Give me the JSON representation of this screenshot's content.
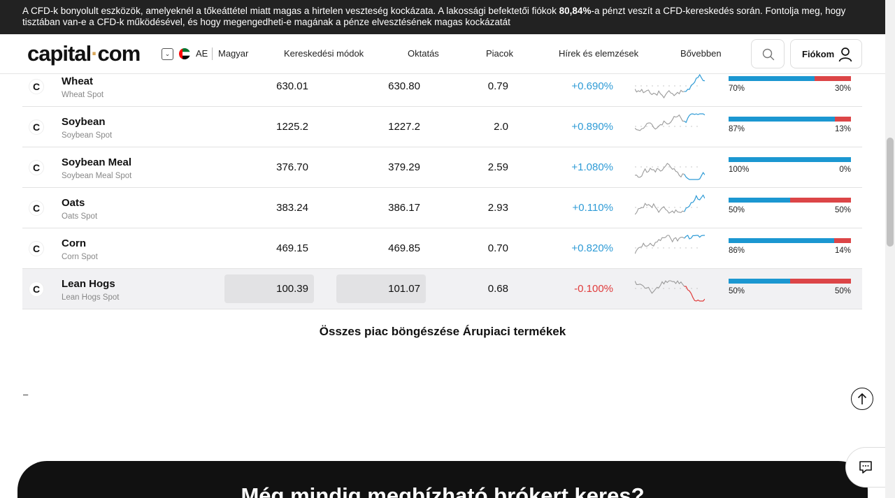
{
  "risk_banner": {
    "part1": "A CFD-k bonyolult eszközök, amelyeknél a tőkeáttétel miatt magas a hirtelen veszteség kockázata. A lakossági befektetői fiókok ",
    "percent": "80,84%",
    "part2": "-a pénzt veszít a CFD-kereskedés során. Fontolja meg, hogy tisztában van-e a CFD-k működésével, és hogy megengedheti-e magának a pénze elvesztésének magas kockázatát"
  },
  "header": {
    "logo_left": "capital",
    "logo_dot": "·",
    "logo_right": "com",
    "region": "AE",
    "language": "Magyar",
    "nav": [
      "Kereskedési módok",
      "Oktatás",
      "Piacok",
      "Hírek és elemzések",
      "Bővebben"
    ],
    "account_label": "Fiókom"
  },
  "markets": [
    {
      "name": "Wheat",
      "sub": "Wheat Spot",
      "sell": "630.01",
      "buy": "630.80",
      "spread": "0.79",
      "change": "+0.690%",
      "direction": "up",
      "buy_pct": 70,
      "buy_label": "70%",
      "sell_label": "30%"
    },
    {
      "name": "Soybean",
      "sub": "Soybean Spot",
      "sell": "1225.2",
      "buy": "1227.2",
      "spread": "2.0",
      "change": "+0.890%",
      "direction": "up",
      "buy_pct": 87,
      "buy_label": "87%",
      "sell_label": "13%"
    },
    {
      "name": "Soybean Meal",
      "sub": "Soybean Meal Spot",
      "sell": "376.70",
      "buy": "379.29",
      "spread": "2.59",
      "change": "+1.080%",
      "direction": "up",
      "buy_pct": 100,
      "buy_label": "100%",
      "sell_label": "0%"
    },
    {
      "name": "Oats",
      "sub": "Oats Spot",
      "sell": "383.24",
      "buy": "386.17",
      "spread": "2.93",
      "change": "+0.110%",
      "direction": "up",
      "buy_pct": 50,
      "buy_label": "50%",
      "sell_label": "50%"
    },
    {
      "name": "Corn",
      "sub": "Corn Spot",
      "sell": "469.15",
      "buy": "469.85",
      "spread": "0.70",
      "change": "+0.820%",
      "direction": "up",
      "buy_pct": 86,
      "buy_label": "86%",
      "sell_label": "14%"
    },
    {
      "name": "Lean Hogs",
      "sub": "Lean Hogs Spot",
      "sell": "100.39",
      "buy": "101.07",
      "spread": "0.68",
      "change": "-0.100%",
      "direction": "down",
      "buy_pct": 50,
      "buy_label": "50%",
      "sell_label": "50%"
    }
  ],
  "browse_link": "Összes piac böngészése Árupiaci termékek",
  "dash_text": "–",
  "cta_title": "Még mindig megbízható brókert keres?",
  "colors": {
    "buy": "#1b97d1",
    "sell": "#dc4547",
    "positive": "#2e9bd6",
    "negative": "#e03c3c",
    "sparkline": "#9a9a9a"
  },
  "icons": {
    "search": "search-icon",
    "account": "user-icon",
    "scroll_top": "arrow-up-icon",
    "chat": "chat-icon",
    "language": "chevron-down-icon",
    "market": "capital-logo-icon"
  }
}
